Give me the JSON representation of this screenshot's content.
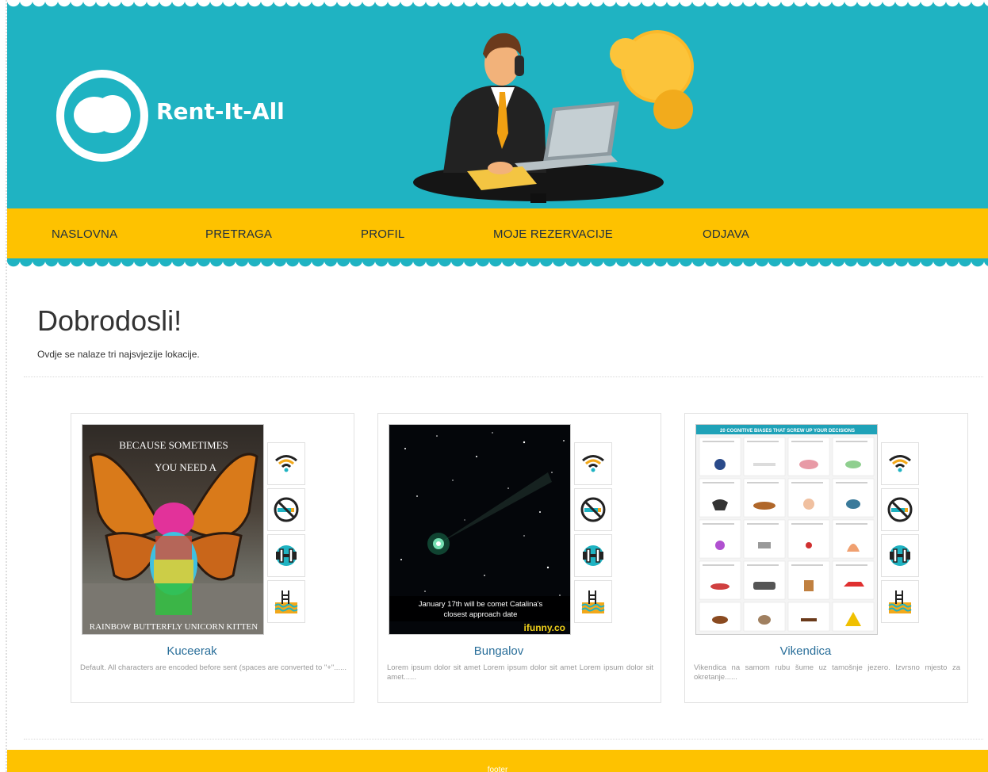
{
  "header": {
    "brand": "Rent-It-All",
    "colors": {
      "teal": "#1fb3c2",
      "yellow": "#fec200"
    }
  },
  "nav": {
    "items": [
      "NASLOVNA",
      "PRETRAGA",
      "PROFIL",
      "MOJE REZERVACIJE",
      "ODJAVA"
    ]
  },
  "main": {
    "title": "Dobrodosli!",
    "subtitle": "Ovdje se nalaze tri najsvjezije lokacije."
  },
  "cards": [
    {
      "name": "Kuceerak",
      "description": "Default. All characters are encoded before sent (spaces are converted to \"+\"......",
      "image_text": [
        "BECAUSE SOMETIMES",
        "YOU NEED A",
        "RAINBOW BUTTERFLY UNICORN KITTEN"
      ],
      "amenities": [
        "wifi-icon",
        "no-smoking-icon",
        "gym-icon",
        "pool-icon"
      ]
    },
    {
      "name": "Bungalov",
      "description": "Lorem ipsum dolor sit amet Lorem ipsum dolor sit amet Lorem ipsum dolor sit amet......",
      "image_text": [
        "January 17th will be comet Catalina's",
        "closest approach date",
        "ifunny.co"
      ],
      "amenities": [
        "wifi-icon",
        "no-smoking-icon",
        "gym-icon",
        "pool-icon"
      ]
    },
    {
      "name": "Vikendica",
      "description": "Vikendica na samom rubu šume uz tamošnje jezero. Izvrsno mjesto za okretanje......",
      "image_text": [
        "20 COGNITIVE BIASES THAT SCREW UP YOUR DECISIONS"
      ],
      "amenities": [
        "wifi-icon",
        "no-smoking-icon",
        "gym-icon",
        "pool-icon"
      ]
    }
  ],
  "footer": {
    "text": "footer"
  }
}
